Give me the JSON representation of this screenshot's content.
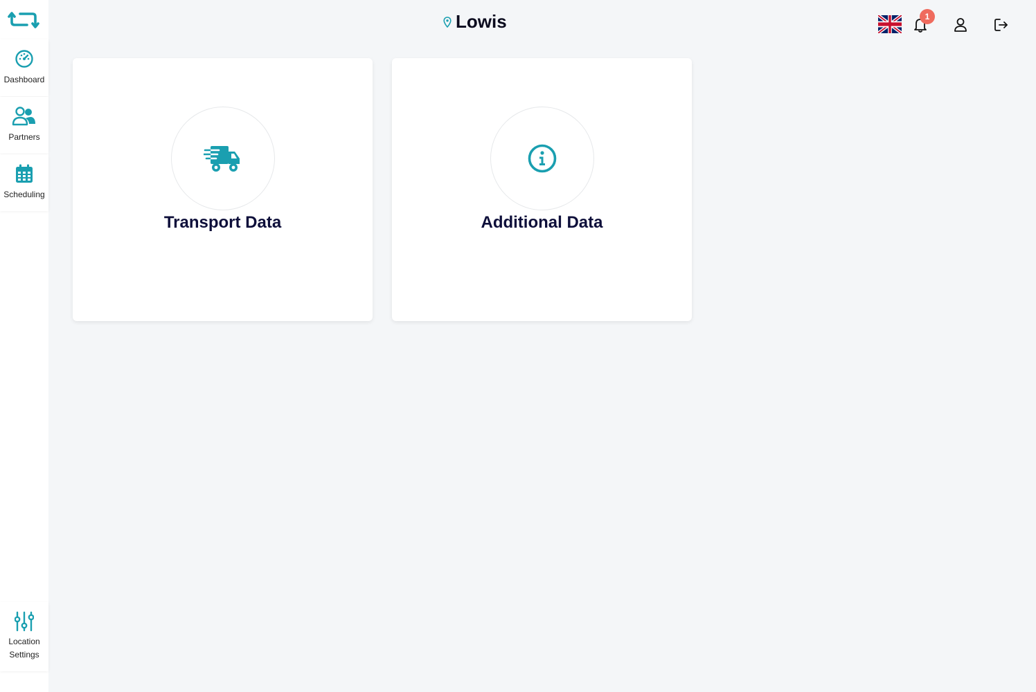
{
  "colors": {
    "accent": "#1a9fb0",
    "title": "#0e0f3a",
    "badge": "#ef6b5e",
    "background": "#f4f6f8"
  },
  "header": {
    "location": "Lowis",
    "notification_count": "1"
  },
  "sidebar": {
    "items": [
      {
        "label": "Dashboard",
        "icon": "gauge-icon"
      },
      {
        "label": "Partners",
        "icon": "users-icon"
      },
      {
        "label": "Scheduling",
        "icon": "calendar-icon"
      }
    ],
    "bottom": {
      "label": "Location Settings",
      "icon": "sliders-icon"
    }
  },
  "cards": [
    {
      "title": "Transport Data",
      "icon": "truck-icon"
    },
    {
      "title": "Additional Data",
      "icon": "info-icon"
    }
  ]
}
